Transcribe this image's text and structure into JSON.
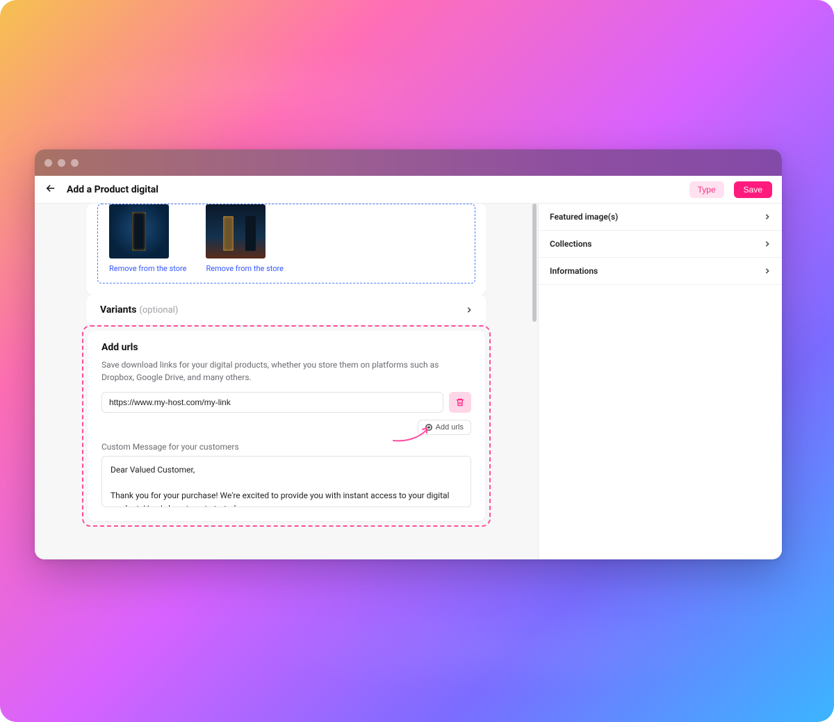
{
  "toolbar": {
    "page_title": "Add a Product digital",
    "type_label": "Type",
    "save_label": "Save"
  },
  "images": {
    "remove_label": "Remove from the store"
  },
  "variants": {
    "label": "Variants",
    "optional": "(optional)"
  },
  "urls": {
    "heading": "Add urls",
    "description": "Save download links for your digital products, whether you store them on platforms such as Dropbox, Google Drive, and many others.",
    "url_value": "https://www.my-host.com/my-link",
    "add_button": "Add urls",
    "message_label": "Custom Message for your customers",
    "message_value": "Dear Valued Customer,\n\nThank you for your purchase! We're excited to provide you with instant access to your digital product. Here's how to get started:"
  },
  "sidebar": {
    "items": [
      "Featured image(s)",
      "Collections",
      "Informations"
    ]
  }
}
